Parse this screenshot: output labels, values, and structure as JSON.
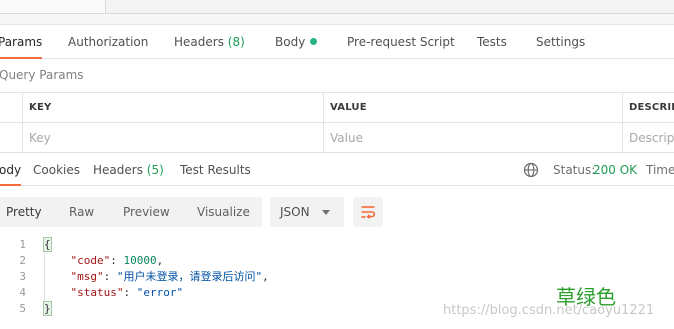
{
  "request_tabs": [
    {
      "label": "Params",
      "active": true
    },
    {
      "label": "Authorization"
    },
    {
      "label": "Headers",
      "count": "(8)"
    },
    {
      "label": "Body",
      "has_dot": true
    },
    {
      "label": "Pre-request Script"
    },
    {
      "label": "Tests"
    },
    {
      "label": "Settings"
    }
  ],
  "query_params": {
    "title": "Query Params",
    "columns": [
      "KEY",
      "VALUE",
      "DESCRIPT"
    ],
    "placeholders": {
      "key": "Key",
      "value": "Value",
      "description": "Descript"
    }
  },
  "response_tabs": [
    {
      "label": "ody",
      "active": true
    },
    {
      "label": "Cookies"
    },
    {
      "label": "Headers",
      "count": "(5)"
    },
    {
      "label": "Test Results"
    }
  ],
  "response_status": {
    "icon": "globe-icon",
    "status_label": "Status:",
    "status_value": "200 OK",
    "status_color": "#1f9d55",
    "time_label": "Time:"
  },
  "view_modes": [
    "Pretty",
    "Raw",
    "Preview",
    "Visualize"
  ],
  "format_select": {
    "selected": "JSON"
  },
  "code_lines": [
    {
      "num": "1",
      "text": "{"
    },
    {
      "num": "2",
      "key": "\"code\"",
      "sep": ": ",
      "val": "10000",
      "val_type": "num",
      "tail": ","
    },
    {
      "num": "3",
      "key": "\"msg\"",
      "sep": ": ",
      "val": "\"用户未登录，请登录后访问\"",
      "val_type": "str",
      "tail": ","
    },
    {
      "num": "4",
      "key": "\"status\"",
      "sep": ": ",
      "val": "\"error\"",
      "val_type": "str",
      "tail": ""
    },
    {
      "num": "5",
      "text": "}"
    }
  ],
  "watermark": {
    "cn": "草绿色",
    "url": "https://blog.csdn.net/caoyu1221"
  },
  "colors": {
    "accent": "#f26b3a",
    "success": "#1f9d55",
    "dot": "#26b47f"
  }
}
